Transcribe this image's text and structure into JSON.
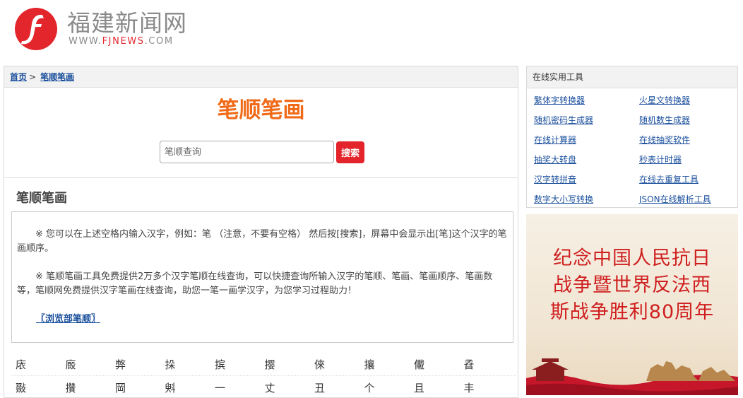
{
  "header": {
    "logo_cn": "福建新闻网",
    "logo_en_prefix": "WWW.",
    "logo_en_brand": "FJNEWS",
    "logo_en_suffix": ".COM",
    "brand_color": "#e3262c"
  },
  "breadcrumb": {
    "home": "首页",
    "separator": ">",
    "current": "笔顺笔画"
  },
  "search": {
    "title": "笔顺笔画",
    "placeholder": "笔顺查询",
    "button_label": "搜索",
    "title_color": "#f06a18",
    "button_color": "#e3242b"
  },
  "content": {
    "section_title": "笔顺笔画",
    "paragraph1": "※ 您可以在上述空格内输入汉字，例如：笔 （注意，不要有空格） 然后按[搜索]，屏幕中会显示出[笔]这个汉字的笔画顺序。",
    "paragraph2": "※ 笔顺笔画工具免费提供2万多个汉字笔顺在线查询，可以快捷查询所输入汉字的笔顺、笔画、笔画顺序、笔画数等，笔顺网免费提供汉字笔画在线查询，助您一笔一画学汉字，为您学习过程助力！",
    "browse_link": "〖浏览部笔顺〗"
  },
  "char_rows": [
    [
      "庡",
      "廄",
      "弊",
      "挆",
      "摈",
      "撄",
      "倈",
      "攘",
      "儎",
      "孴"
    ],
    [
      "敠",
      "攢",
      "岡",
      "斞",
      "一",
      "丈",
      "丑",
      "个",
      "且",
      "丰"
    ]
  ],
  "sidebar": {
    "tools_title": "在线实用工具",
    "tools": [
      "繁体字转换器",
      "火星文转换器",
      "随机密码生成器",
      "随机数生成器",
      "在线计算器",
      "在线抽奖软件",
      "抽奖大转盘",
      "秒表计时器",
      "汉字转拼音",
      "在线去重复工具",
      "数字大小写转换",
      "JSON在线解析工具"
    ],
    "banner_lines": [
      "纪念中国人民抗日",
      "战争暨世界反法西",
      "斯战争胜利80周年"
    ],
    "banner_text_color": "#cf1f1f"
  }
}
